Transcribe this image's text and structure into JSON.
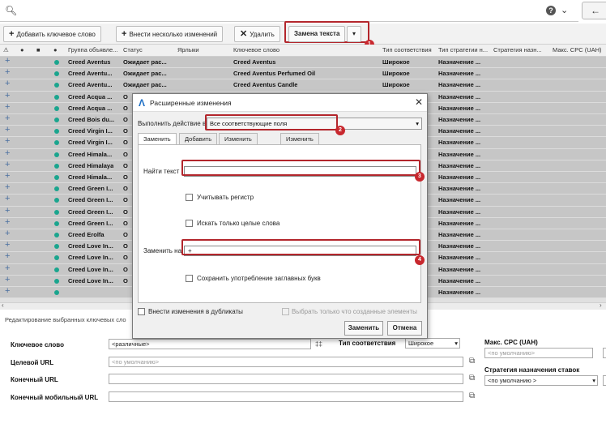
{
  "search": {
    "placeholder": ""
  },
  "toolbar": {
    "add_keyword": "Добавить ключевое слово",
    "bulk_changes": "Внести несколько изменений",
    "delete": "Удалить",
    "replace_text": "Замена текста"
  },
  "badges": [
    "1",
    "2",
    "3",
    "4"
  ],
  "grid": {
    "headers": [
      "Группа объявле...",
      "Статус",
      "Ярлыки",
      "Ключевое слово",
      "Тип соответствия",
      "Тип стратегии н...",
      "Стратегия назн...",
      "Макс. CPC (UAH)"
    ],
    "rows": [
      {
        "group": "Creed Aventus",
        "status": "Ожидает рас...",
        "keyword": "Creed Aventus",
        "match": "Широкое",
        "strategy": "Назначение ..."
      },
      {
        "group": "Creed Aventu...",
        "status": "Ожидает рас...",
        "keyword": "Creed Aventus Perfumed Oil",
        "match": "Широкое",
        "strategy": "Назначение ..."
      },
      {
        "group": "Creed Aventu...",
        "status": "Ожидает рас...",
        "keyword": "Creed Aventus Candle",
        "match": "Широкое",
        "strategy": "Назначение ..."
      },
      {
        "group": "Creed Acqua ...",
        "status": "О",
        "keyword": "",
        "match": "",
        "strategy": "Назначение ..."
      },
      {
        "group": "Creed Acqua ...",
        "status": "О",
        "keyword": "",
        "match": "",
        "strategy": "Назначение ..."
      },
      {
        "group": "Creed Bois du...",
        "status": "О",
        "keyword": "",
        "match": "",
        "strategy": "Назначение ..."
      },
      {
        "group": "Creed Virgin I...",
        "status": "О",
        "keyword": "",
        "match": "",
        "strategy": "Назначение ..."
      },
      {
        "group": "Creed Virgin I...",
        "status": "О",
        "keyword": "",
        "match": "",
        "strategy": "Назначение ..."
      },
      {
        "group": "Creed Himala...",
        "status": "О",
        "keyword": "",
        "match": "",
        "strategy": "Назначение ..."
      },
      {
        "group": "Creed Himalaya",
        "status": "О",
        "keyword": "",
        "match": "",
        "strategy": "Назначение ..."
      },
      {
        "group": "Creed Himala...",
        "status": "О",
        "keyword": "",
        "match": "",
        "strategy": "Назначение ..."
      },
      {
        "group": "Creed Green I...",
        "status": "О",
        "keyword": "",
        "match": "",
        "strategy": "Назначение ..."
      },
      {
        "group": "Creed Green I...",
        "status": "О",
        "keyword": "",
        "match": "",
        "strategy": "Назначение ..."
      },
      {
        "group": "Creed Green I...",
        "status": "О",
        "keyword": "",
        "match": "",
        "strategy": "Назначение ..."
      },
      {
        "group": "Creed Green I...",
        "status": "О",
        "keyword": "",
        "match": "",
        "strategy": "Назначение ..."
      },
      {
        "group": "Creed Erolfa",
        "status": "О",
        "keyword": "",
        "match": "",
        "strategy": "Назначение ..."
      },
      {
        "group": "Creed Love In...",
        "status": "О",
        "keyword": "",
        "match": "",
        "strategy": "Назначение ..."
      },
      {
        "group": "Creed Love In...",
        "status": "О",
        "keyword": "",
        "match": "",
        "strategy": "Назначение ..."
      },
      {
        "group": "Creed Love In...",
        "status": "О",
        "keyword": "",
        "match": "",
        "strategy": "Назначение ..."
      },
      {
        "group": "Creed Love In...",
        "status": "О",
        "keyword": "",
        "match": "",
        "strategy": "Назначение ..."
      },
      {
        "group": "",
        "status": "",
        "keyword": "",
        "match": "",
        "strategy": "Назначение ..."
      }
    ]
  },
  "edit_panel": {
    "title": "Редактирование выбранных ключевых сло",
    "keyword_label": "Ключевое слово",
    "keyword_value": "<различные>",
    "target_url_label": "Целевой URL",
    "target_url_placeholder": "<по умолчанию>",
    "final_url_label": "Конечный URL",
    "final_mobile_url_label": "Конечный мобильный URL",
    "match_type_label": "Тип соответствия",
    "match_type_value": "Широкое",
    "max_cpc_label": "Макс. CPC (UAH)",
    "max_cpc_placeholder": "<по умолчанию>",
    "bid_strategy_label": "Стратегия назначения ставок",
    "bid_strategy_value": "<по умолчанию >",
    "right_placeholder": "<п",
    "right_value": "<"
  },
  "dialog": {
    "title": "Расширенные изменения",
    "perform_in_label": "Выполнить действие в:",
    "perform_in_value": "Все соответствующие поля",
    "tabs": [
      "Заменить",
      "Добавить",
      "Изменить ставки",
      "Изменить URL"
    ],
    "find_label": "Найти текст",
    "find_value": "",
    "match_case": "Учитывать регистр",
    "whole_words": "Искать только целые слова",
    "replace_label": "Заменить на",
    "replace_value": "+",
    "keep_caps": "Сохранить употребление заглавных букв",
    "duplicates": "Внести изменения в дубликаты",
    "only_new": "Выбрать только что созданные элементы",
    "ok": "Заменить",
    "cancel": "Отмена"
  },
  "colors": {
    "accent": "#b3262c",
    "status_dot": "#1aa58e",
    "logo": "#1e6fc5"
  }
}
